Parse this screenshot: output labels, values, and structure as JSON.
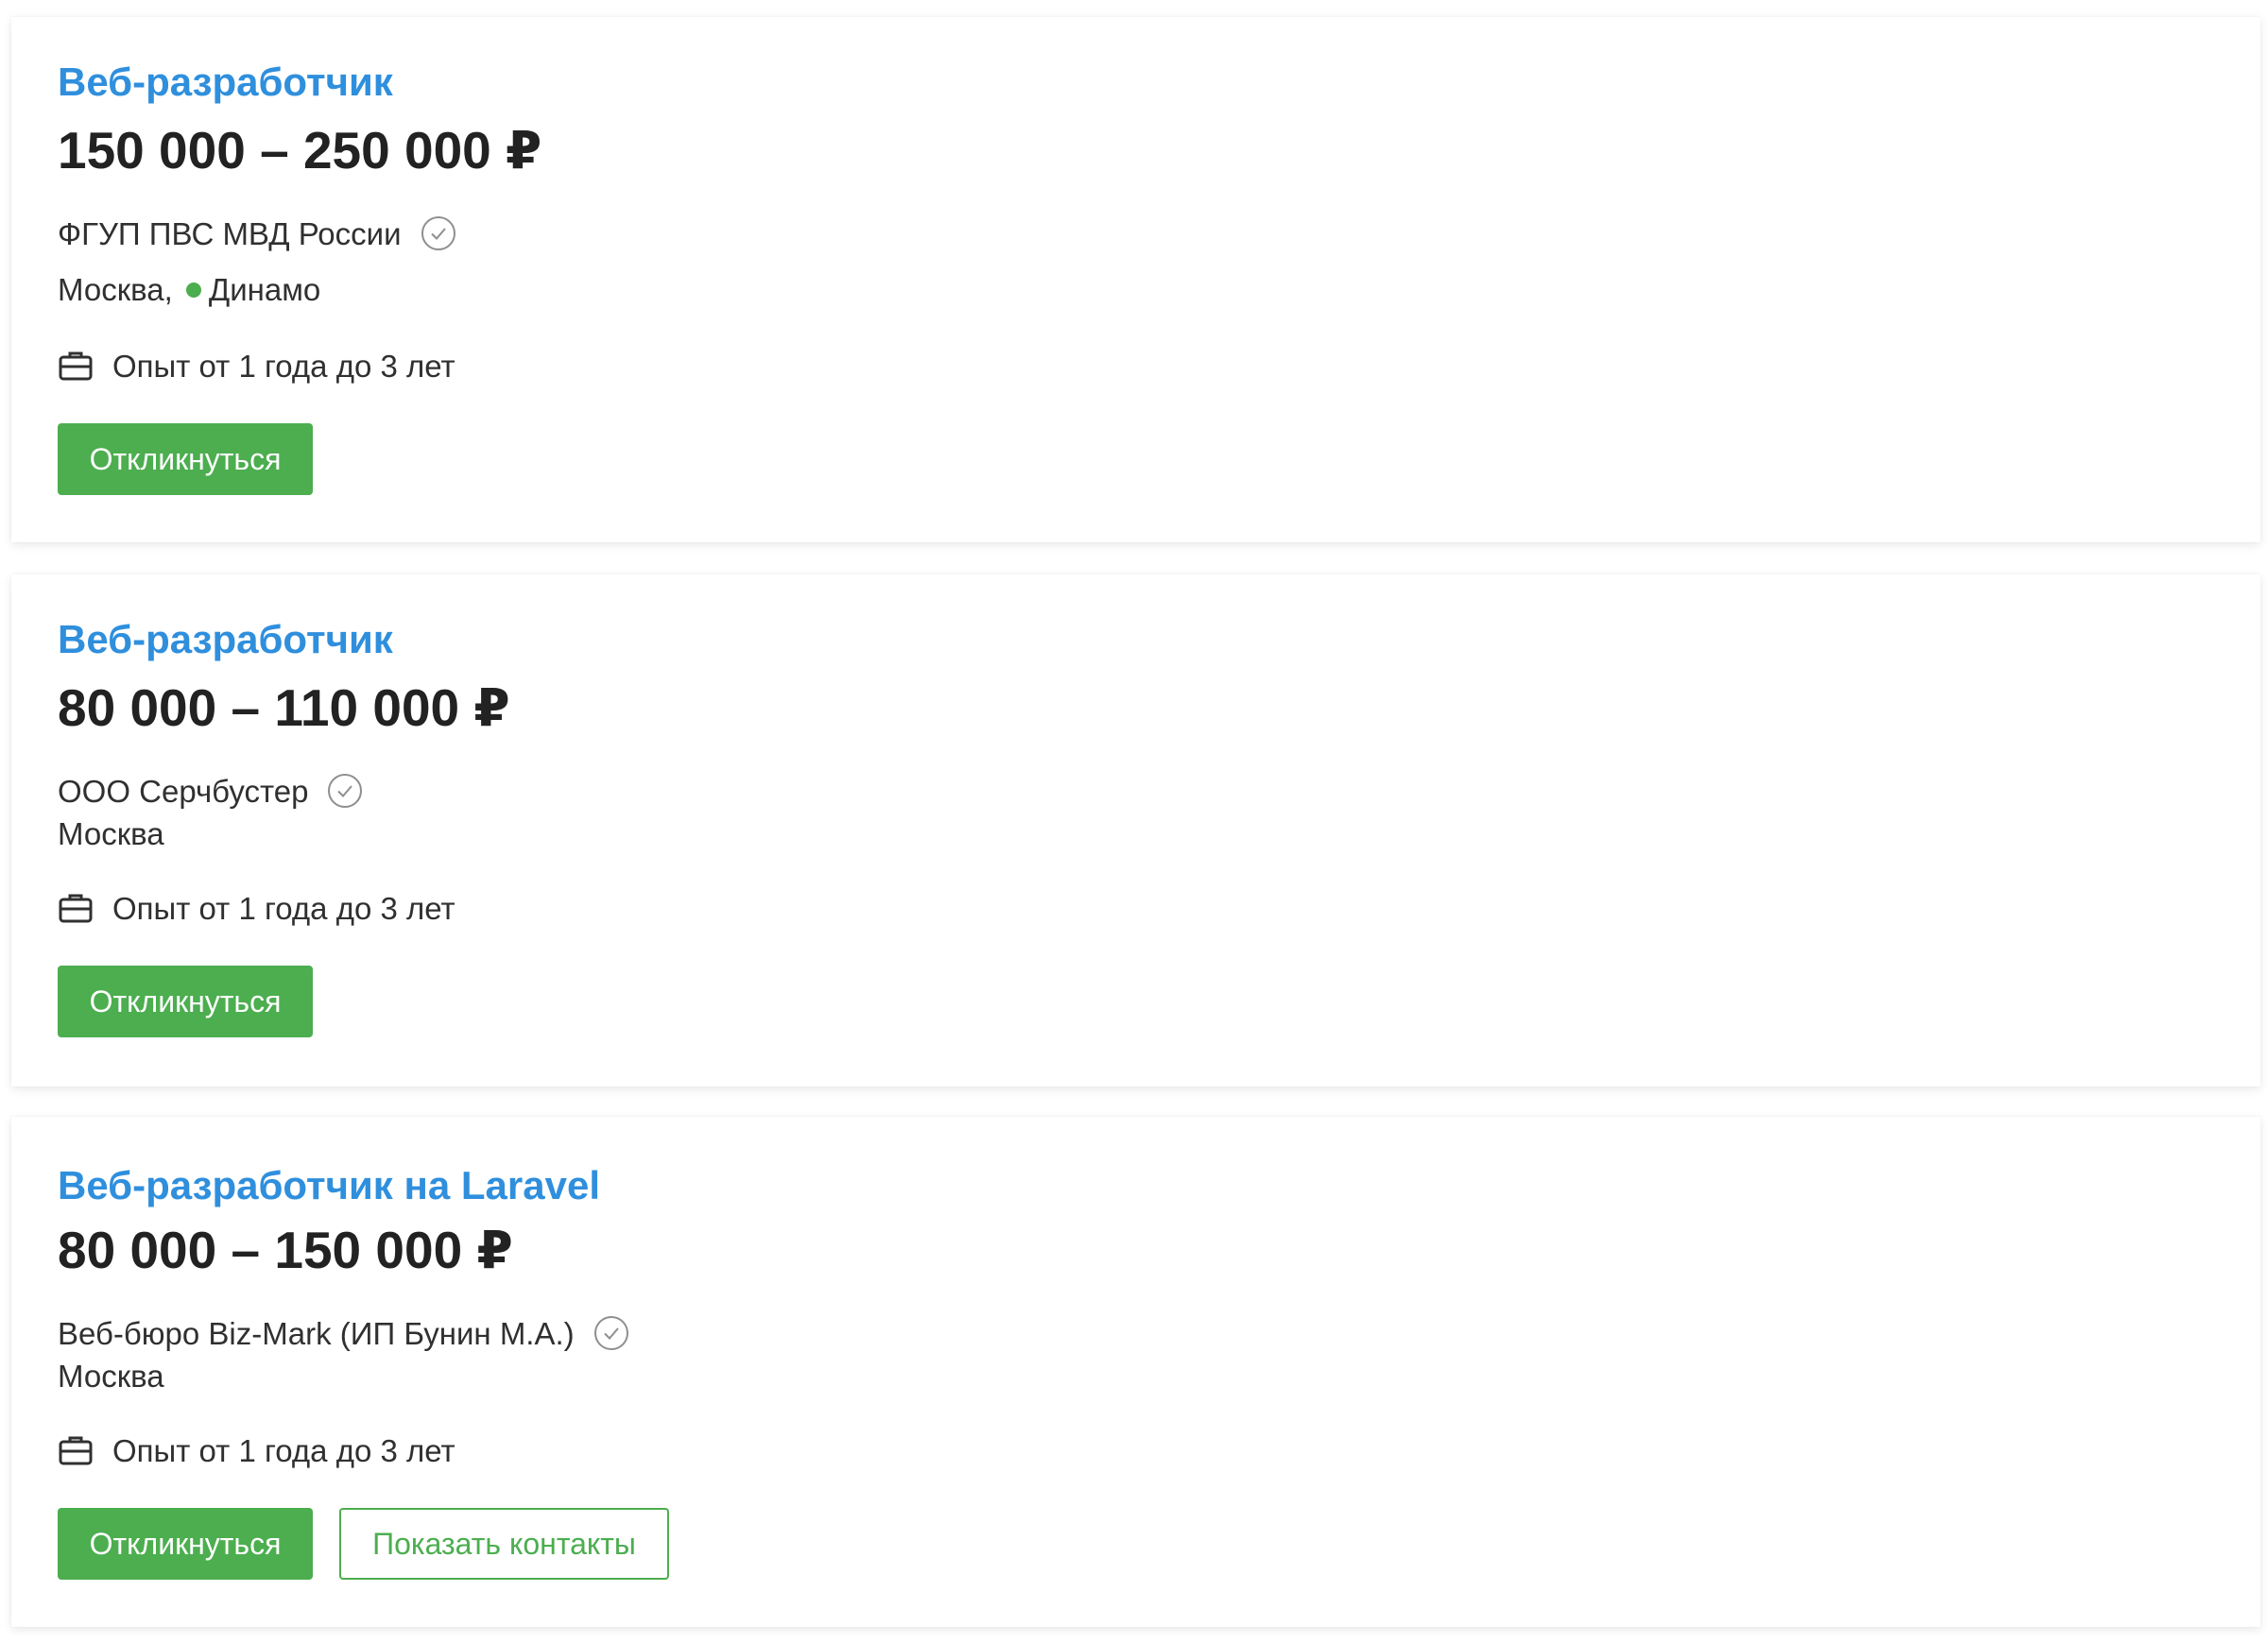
{
  "vacancies": [
    {
      "title": "Веб-разработчик",
      "salary": "150 000 – 250 000 ₽",
      "company": "ФГУП ПВС МВД России",
      "city": "Москва,",
      "metro": "Динамо",
      "experience": "Опыт от 1 года до 3 лет",
      "apply_label": "Откликнуться"
    },
    {
      "title": "Веб-разработчик",
      "salary": "80 000 – 110 000 ₽",
      "company": "ООО Серчбустер",
      "city": "Москва",
      "experience": "Опыт от 1 года до 3 лет",
      "apply_label": "Откликнуться"
    },
    {
      "title": "Веб-разработчик на Laravel",
      "salary": "80 000 – 150 000 ₽",
      "company": "Веб-бюро Biz-Mark (ИП Бунин М.А.)",
      "city": "Москва",
      "experience": "Опыт от 1 года до 3 лет",
      "apply_label": "Откликнуться",
      "contacts_label": "Показать контакты"
    }
  ],
  "colors": {
    "title": "#2f8fdd",
    "accent_green": "#4cae4f",
    "text": "#303030",
    "salary": "#222222"
  },
  "icons": {
    "verified": "check-circle-icon",
    "experience": "briefcase-icon",
    "metro": "metro-dot-icon"
  }
}
